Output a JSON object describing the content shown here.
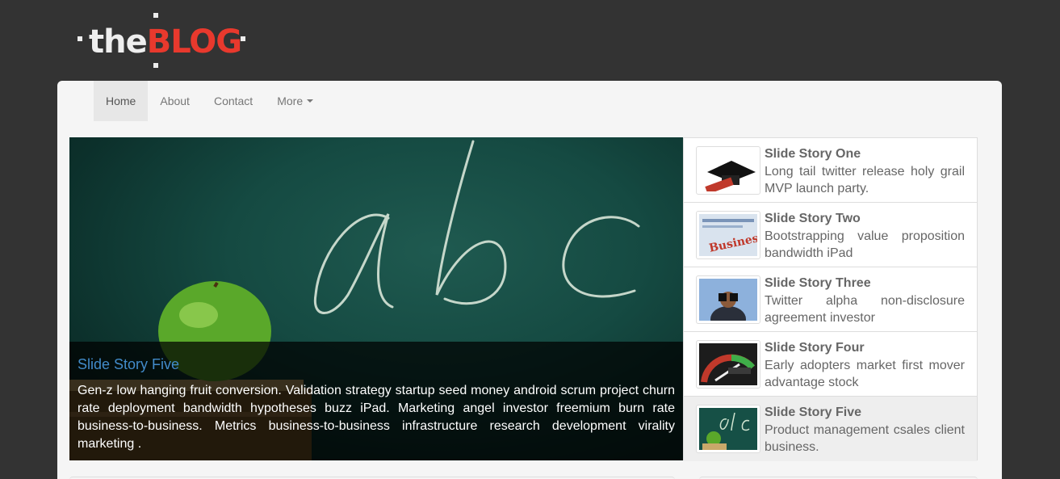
{
  "logo": {
    "the": "the",
    "blog": "BLOG"
  },
  "nav": [
    {
      "label": "Home"
    },
    {
      "label": "About"
    },
    {
      "label": "Contact"
    },
    {
      "label": "More"
    }
  ],
  "hero": {
    "title": "Slide Story Five",
    "text": "Gen-z low hanging fruit conversion. Validation strategy startup seed money android scrum project churn rate deployment bandwidth hypotheses buzz iPad. Marketing angel investor freemium burn rate business-to-business. Metrics business-to-business infrastructure research development virality marketing .",
    "chalk_text": "abc"
  },
  "stories": [
    {
      "title": "Slide Story One",
      "text": "Long tail twitter release holy grail MVP launch party.",
      "icon": "graduation-cap-icon"
    },
    {
      "title": "Slide Story Two",
      "text": "Bootstrapping value proposition bandwidth iPad",
      "icon": "business-newspaper-icon"
    },
    {
      "title": "Slide Story Three",
      "text": "Twitter alpha non-disclosure agreement investor",
      "icon": "binoculars-man-icon"
    },
    {
      "title": "Slide Story Four",
      "text": "Early adopters market first mover advantage stock",
      "icon": "success-gauge-icon"
    },
    {
      "title": "Slide Story Five",
      "text": "Product management csales client business.",
      "icon": "chalkboard-apple-icon"
    }
  ],
  "colors": {
    "background": "#333333",
    "panel": "#f5f5f5",
    "accent_red": "#e8392d",
    "caption_title": "#428bca"
  },
  "active_story_index": 4
}
